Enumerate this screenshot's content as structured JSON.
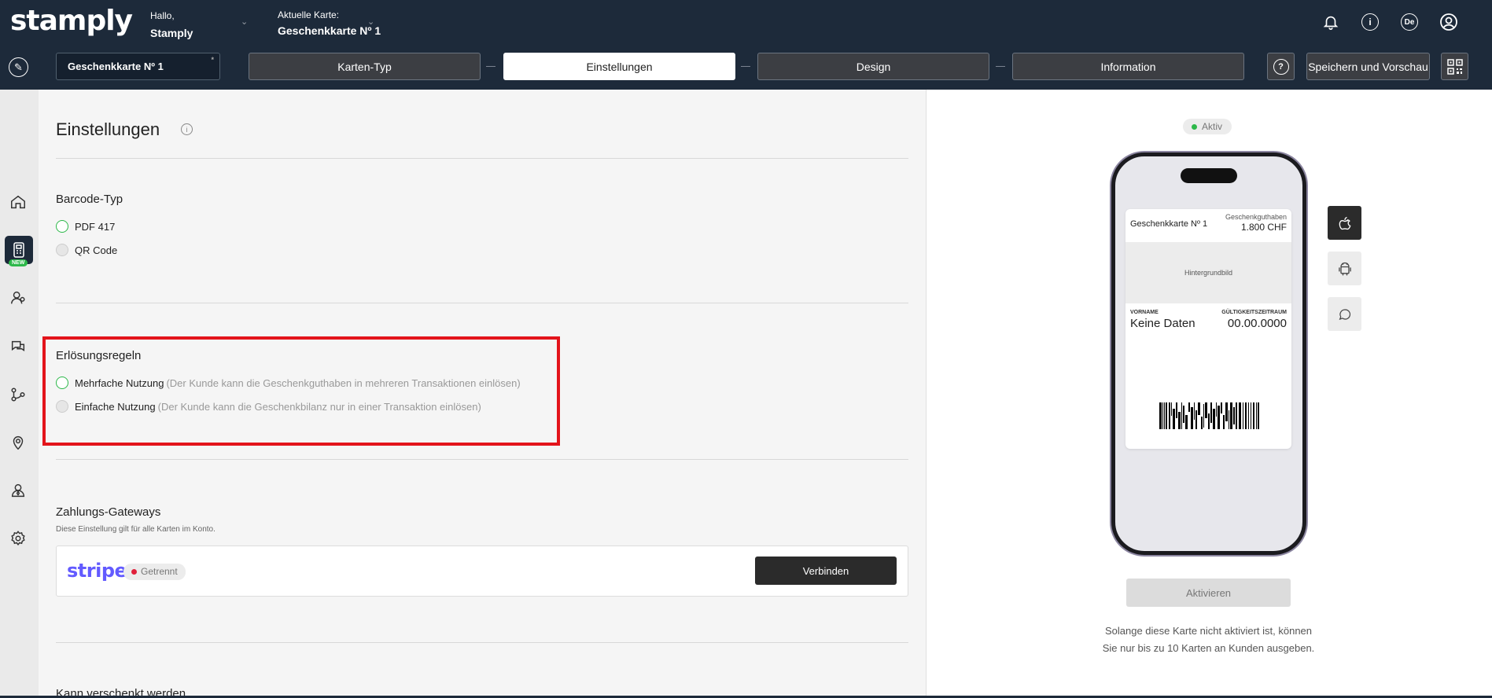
{
  "header": {
    "logo": "stamply",
    "greeting_label": "Hallo,",
    "user_name": "Stamply",
    "current_card_label": "Aktuelle Karte:",
    "current_card_name": "Geschenkkarte Nº 1",
    "language": "De",
    "icons": [
      "bell-icon",
      "info-icon",
      "language-icon",
      "user-icon"
    ]
  },
  "toolbar": {
    "card_name": "Geschenkkarte Nº 1",
    "card_name_marker": "*",
    "steps": [
      {
        "label": "Karten-Typ",
        "active": false
      },
      {
        "label": "Einstellungen",
        "active": true
      },
      {
        "label": "Design",
        "active": false
      },
      {
        "label": "Information",
        "active": false
      }
    ],
    "help_label": "?",
    "save_label": "Speichern und Vorschau"
  },
  "sidebar": {
    "items": [
      {
        "icon": "home-icon",
        "active": false
      },
      {
        "icon": "card-terminal-icon",
        "active": true,
        "badge": "NEW"
      },
      {
        "icon": "customers-icon",
        "active": false
      },
      {
        "icon": "chat-icon",
        "active": false
      },
      {
        "icon": "workflow-icon",
        "active": false
      },
      {
        "icon": "location-icon",
        "active": false
      },
      {
        "icon": "manager-icon",
        "active": false
      },
      {
        "icon": "settings-icon",
        "active": false
      }
    ]
  },
  "main": {
    "title": "Einstellungen",
    "info_glyph": "i",
    "barcode": {
      "heading": "Barcode-Typ",
      "options": [
        {
          "label": "PDF 417",
          "selected": true
        },
        {
          "label": "QR Code",
          "selected": false
        }
      ]
    },
    "redemption": {
      "heading": "Erlösungsregeln",
      "options": [
        {
          "label": "Mehrfache Nutzung",
          "hint": "(Der Kunde kann die Geschenkguthaben in mehreren Transaktionen einlösen)",
          "selected": true
        },
        {
          "label": "Einfache Nutzung",
          "hint": "(Der Kunde kann die Geschenkbilanz nur in einer Transaktion einlösen)",
          "selected": false
        }
      ]
    },
    "payment": {
      "heading": "Zahlungs-Gateways",
      "note": "Diese Einstellung gilt für alle Karten im Konto.",
      "provider": "stripe",
      "status": "Getrennt",
      "connect_label": "Verbinden"
    },
    "next_heading": "Kann verschenkt werden"
  },
  "preview": {
    "status": "Aktiv",
    "pass": {
      "name": "Geschenkkarte Nº 1",
      "balance_label": "Geschenkguthaben",
      "balance": "1.800 CHF",
      "background_label": "Hintergrundbild",
      "field1_label": "VORNAME",
      "field1_value": "Keine Daten",
      "field2_label": "GÜLTIGKEITSZEITRAUM",
      "field2_value": "00.00.0000"
    },
    "platforms": [
      "apple-icon",
      "android-icon",
      "message-icon"
    ],
    "activate_label": "Aktivieren",
    "note": "Solange diese Karte nicht aktiviert ist, können Sie nur bis zu 10 Karten an Kunden ausgeben.",
    "colors": {
      "header": "#1d2a3a",
      "active": "#2db84a",
      "inactive": "#e0203a",
      "stripe": "#635bff",
      "highlight": "#e3141b"
    }
  }
}
